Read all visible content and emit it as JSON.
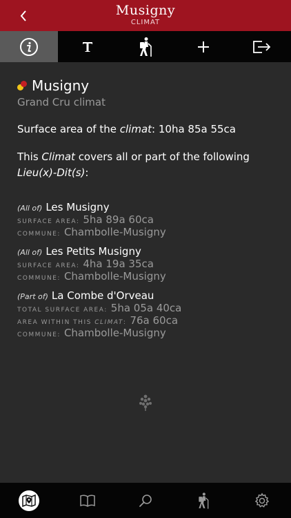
{
  "header": {
    "title": "Musigny",
    "subtitle": "CLIMAT"
  },
  "icons": {
    "back": "chevron-left-icon",
    "info": "info-icon",
    "text": "text-icon",
    "hiker": "hiker-icon",
    "add": "plus-icon",
    "share": "share-icon",
    "map": "map-pin-icon",
    "book": "book-icon",
    "search": "search-icon",
    "settings": "gear-icon"
  },
  "climat": {
    "name": "Musigny",
    "classification": "Grand Cru climat",
    "dot_colors": [
      "#f0c419",
      "#c21f24"
    ],
    "surface_prefix": "Surface area of the ",
    "surface_em": "climat",
    "surface_suffix": ": 10ha 85a 55ca",
    "covers_1": "This ",
    "covers_em": "Climat",
    "covers_2": " covers all or part of the following",
    "covers_em2": "Lieu(x)-Dit(s)",
    "covers_3": ":"
  },
  "lieux": [
    {
      "qualifier": "(All of)",
      "name": "Les Musigny",
      "surface_label": "Surface area:",
      "surface_value": "5ha 89a 60ca",
      "commune_label": "Commune:",
      "commune_value": "Chambolle-Musigny"
    },
    {
      "qualifier": "(All of)",
      "name": "Les Petits Musigny",
      "surface_label": "Surface area:",
      "surface_value": "4ha 19a 35ca",
      "commune_label": "Commune:",
      "commune_value": "Chambolle-Musigny"
    },
    {
      "qualifier": "(Part of)",
      "name": "La Combe d'Orveau",
      "surface_label": "Total surface area:",
      "surface_value": "5ha 05a 40ca",
      "within_label_1": "Area within this ",
      "within_label_em": "climat",
      "within_label_2": ":",
      "within_value": "76a 60ca",
      "commune_label": "Commune:",
      "commune_value": "Chambolle-Musigny"
    }
  ],
  "colors": {
    "header": "#9e1420",
    "background": "#2a2a2a",
    "toolbar": "#050505",
    "muted": "#9a9a9a"
  }
}
